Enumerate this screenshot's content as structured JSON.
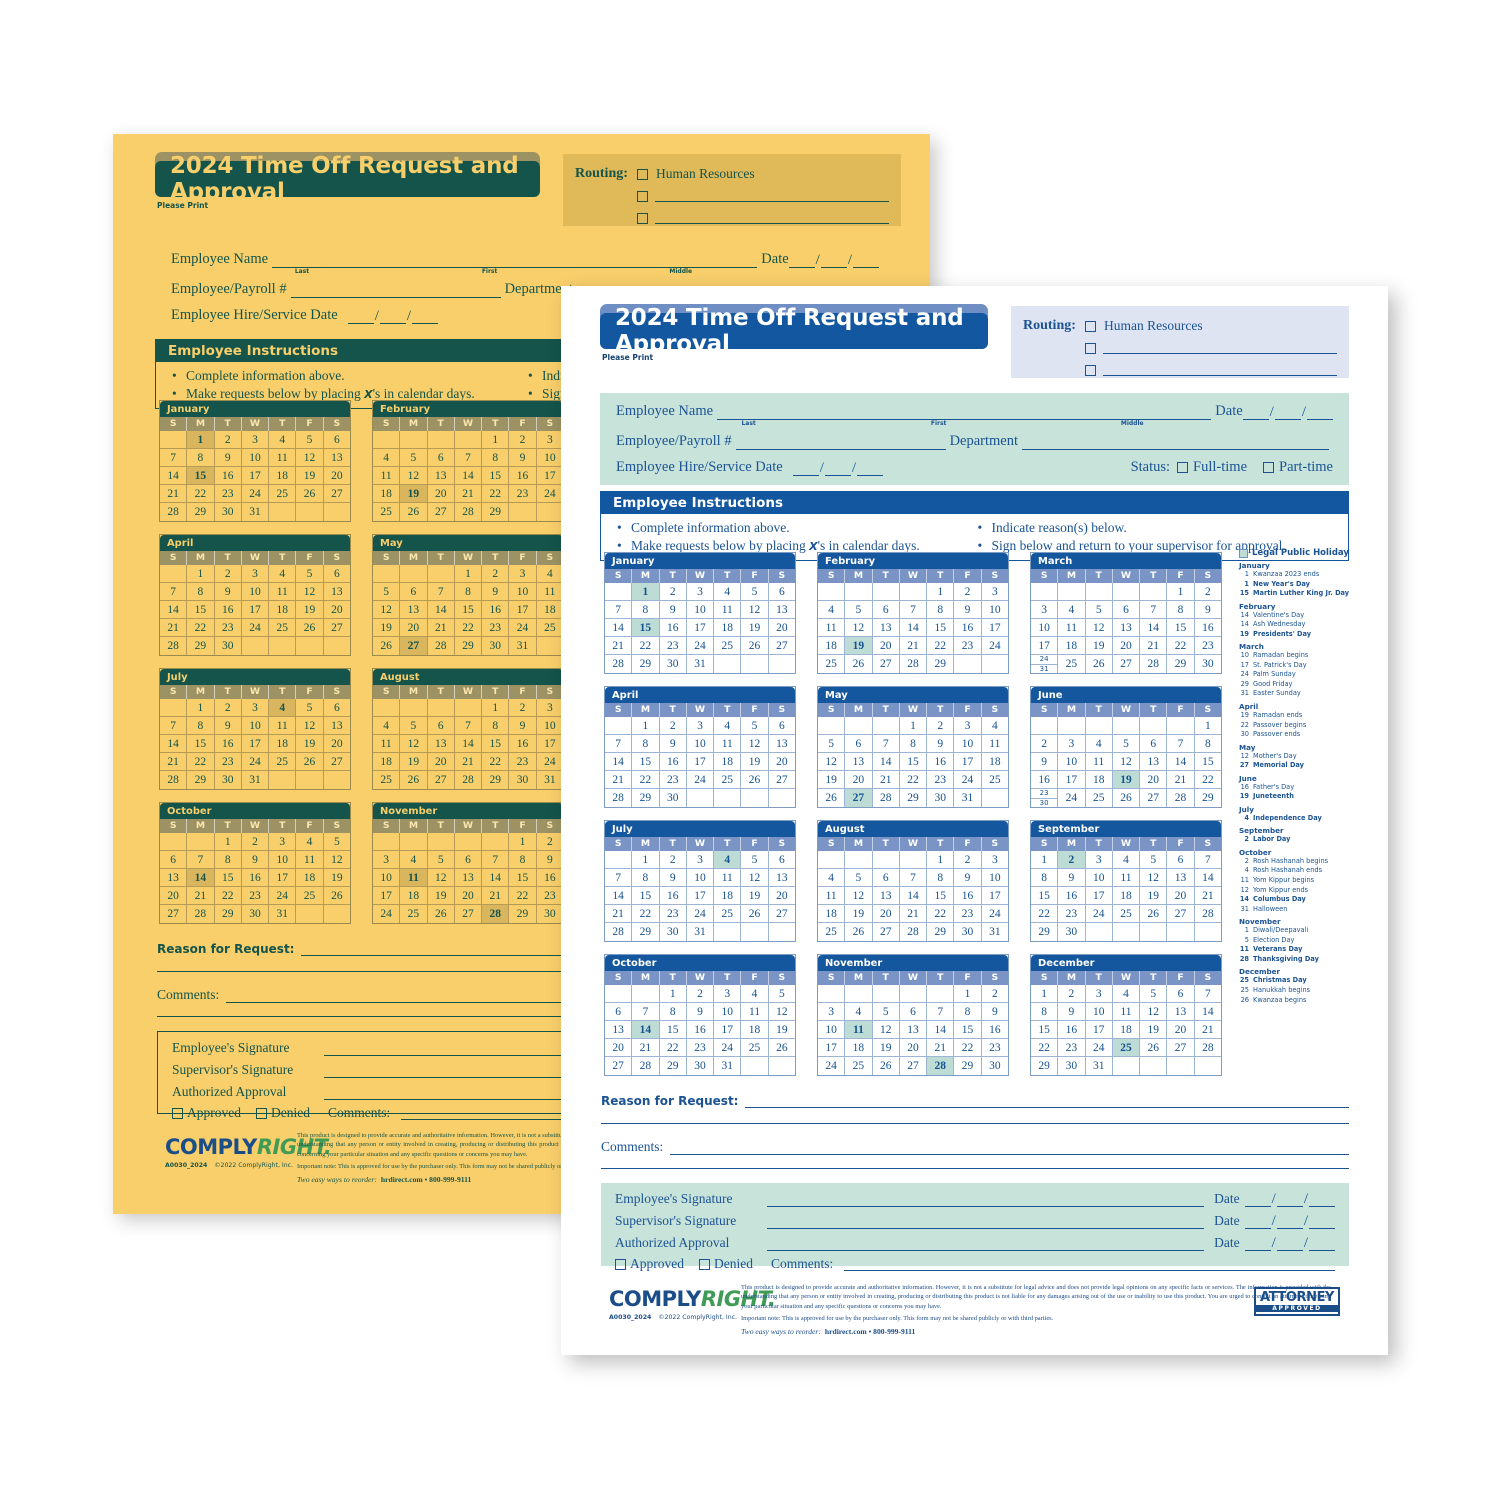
{
  "form": {
    "title": "2024 Time Off Request and Approval",
    "please_print": "Please Print",
    "routing": {
      "label": "Routing:",
      "first_option": "Human Resources",
      "blank_rows": 2
    },
    "employee": {
      "name_label": "Employee Name",
      "sub_last": "Last",
      "sub_first": "First",
      "sub_middle": "Middle",
      "date_label": "Date",
      "payroll_label": "Employee/Payroll #",
      "department_label": "Department",
      "hire_label": "Employee Hire/Service Date",
      "status_label": "Status:",
      "status_fulltime": "Full-time",
      "status_parttime": "Part-time"
    },
    "instructions": {
      "heading": "Employee Instructions",
      "left": [
        "Complete information above.",
        "Make requests below by placing X's in calendar days."
      ],
      "right": [
        "Indicate reason(s) below.",
        "Sign below and return to your supervisor for approval."
      ]
    },
    "reason_label": "Reason for Request:",
    "comments_label": "Comments:",
    "signatures": {
      "employee": "Employee's Signature",
      "supervisor": "Supervisor's Signature",
      "authorized": "Authorized Approval",
      "date_label": "Date",
      "approved": "Approved",
      "denied": "Denied",
      "comments": "Comments:"
    },
    "footer": {
      "logo_comply": "COMPLY",
      "logo_right": "RIGHT.",
      "sku": "A0030_2024",
      "copyright": "©2022 ComplyRight, Inc.",
      "reorder_prefix": "Two easy ways to reorder:",
      "reorder_contact": "hrdirect.com • 800-999-9111",
      "disclaimer_1": "This product is designed to provide accurate and authoritative information. However, it is not a substitute for legal advice and does not provide legal opinions on any specific facts or services. The information is provided with the understanding that any person or entity involved in creating, producing or distributing this product is not liable for any damages arising out of the use or inability to use this product. You are urged to consult an attorney concerning your particular situation and any specific questions or concerns you may have.",
      "disclaimer_2": "Important note: This is approved for use by the purchaser only. This form may not be shared publicly or with third parties.",
      "attorney_line1": "ATTORNEY",
      "attorney_line2": "APPROVED"
    }
  },
  "calendar": {
    "dow": [
      "S",
      "M",
      "T",
      "W",
      "T",
      "F",
      "S"
    ],
    "legend_label": "Legal Public Holiday",
    "months": [
      {
        "name": "January",
        "lead": 1,
        "days": 31,
        "holidays": [
          1,
          15
        ]
      },
      {
        "name": "February",
        "lead": 4,
        "days": 29,
        "holidays": [
          19
        ]
      },
      {
        "name": "March",
        "lead": 5,
        "days": 31,
        "holidays": [],
        "split": {
          "cell": 24,
          "extra": 31
        }
      },
      {
        "name": "April",
        "lead": 1,
        "days": 30,
        "holidays": []
      },
      {
        "name": "May",
        "lead": 3,
        "days": 31,
        "holidays": [
          27
        ]
      },
      {
        "name": "June",
        "lead": 6,
        "days": 30,
        "holidays": [
          19
        ],
        "split": {
          "cell": 23,
          "extra": 30
        }
      },
      {
        "name": "July",
        "lead": 1,
        "days": 31,
        "holidays": [
          4
        ]
      },
      {
        "name": "August",
        "lead": 4,
        "days": 31,
        "holidays": []
      },
      {
        "name": "September",
        "lead": 0,
        "days": 30,
        "holidays": [
          2
        ]
      },
      {
        "name": "October",
        "lead": 2,
        "days": 31,
        "holidays": [
          14
        ]
      },
      {
        "name": "November",
        "lead": 5,
        "days": 30,
        "holidays": [
          11,
          28
        ]
      },
      {
        "name": "December",
        "lead": 0,
        "days": 31,
        "holidays": [
          25
        ]
      }
    ]
  },
  "holidays": [
    {
      "month": "January",
      "items": [
        {
          "day": "1",
          "name": "Kwanzaa 2023 ends",
          "bold": false
        },
        {
          "day": "1",
          "name": "New Year's Day",
          "bold": true
        },
        {
          "day": "15",
          "name": "Martin Luther King Jr. Day",
          "bold": true
        }
      ]
    },
    {
      "month": "February",
      "items": [
        {
          "day": "14",
          "name": "Valentine's Day",
          "bold": false
        },
        {
          "day": "14",
          "name": "Ash Wednesday",
          "bold": false
        },
        {
          "day": "19",
          "name": "Presidents' Day",
          "bold": true
        }
      ]
    },
    {
      "month": "March",
      "items": [
        {
          "day": "10",
          "name": "Ramadan begins",
          "bold": false
        },
        {
          "day": "17",
          "name": "St. Patrick's Day",
          "bold": false
        },
        {
          "day": "24",
          "name": "Palm Sunday",
          "bold": false
        },
        {
          "day": "29",
          "name": "Good Friday",
          "bold": false
        },
        {
          "day": "31",
          "name": "Easter Sunday",
          "bold": false
        }
      ]
    },
    {
      "month": "April",
      "items": [
        {
          "day": "19",
          "name": "Ramadan ends",
          "bold": false
        },
        {
          "day": "22",
          "name": "Passover begins",
          "bold": false
        },
        {
          "day": "30",
          "name": "Passover ends",
          "bold": false
        }
      ]
    },
    {
      "month": "May",
      "items": [
        {
          "day": "12",
          "name": "Mother's Day",
          "bold": false
        },
        {
          "day": "27",
          "name": "Memorial Day",
          "bold": true
        }
      ]
    },
    {
      "month": "June",
      "items": [
        {
          "day": "16",
          "name": "Father's Day",
          "bold": false
        },
        {
          "day": "19",
          "name": "Juneteenth",
          "bold": true
        }
      ]
    },
    {
      "month": "July",
      "items": [
        {
          "day": "4",
          "name": "Independence Day",
          "bold": true
        }
      ]
    },
    {
      "month": "September",
      "items": [
        {
          "day": "2",
          "name": "Labor Day",
          "bold": true
        }
      ]
    },
    {
      "month": "October",
      "items": [
        {
          "day": "2",
          "name": "Rosh Hashanah begins",
          "bold": false
        },
        {
          "day": "4",
          "name": "Rosh Hashanah ends",
          "bold": false
        },
        {
          "day": "11",
          "name": "Yom Kippur begins",
          "bold": false
        },
        {
          "day": "12",
          "name": "Yom Kippur ends",
          "bold": false
        },
        {
          "day": "14",
          "name": "Columbus Day",
          "bold": true
        },
        {
          "day": "31",
          "name": "Halloween",
          "bold": false
        }
      ]
    },
    {
      "month": "November",
      "items": [
        {
          "day": "1",
          "name": "Diwali/Deepavali",
          "bold": false
        },
        {
          "day": "5",
          "name": "Election Day",
          "bold": false
        },
        {
          "day": "11",
          "name": "Veterans Day",
          "bold": true
        },
        {
          "day": "28",
          "name": "Thanksgiving Day",
          "bold": true
        }
      ]
    },
    {
      "month": "December",
      "items": [
        {
          "day": "25",
          "name": "Christmas Day",
          "bold": true
        },
        {
          "day": "25",
          "name": "Hanukkah begins",
          "bold": false
        },
        {
          "day": "26",
          "name": "Kwanzaa begins",
          "bold": false
        }
      ]
    }
  ],
  "colors": {
    "white_accent": "#12579f",
    "white_band": "#c7e3da",
    "white_routing": "#dfe4f2",
    "white_holiday": "#bcdcd5",
    "gold_paper": "#f8cf6b",
    "gold_accent": "#14544a",
    "gold_routing": "#e0b959",
    "gold_holiday": "#d9b65e"
  }
}
